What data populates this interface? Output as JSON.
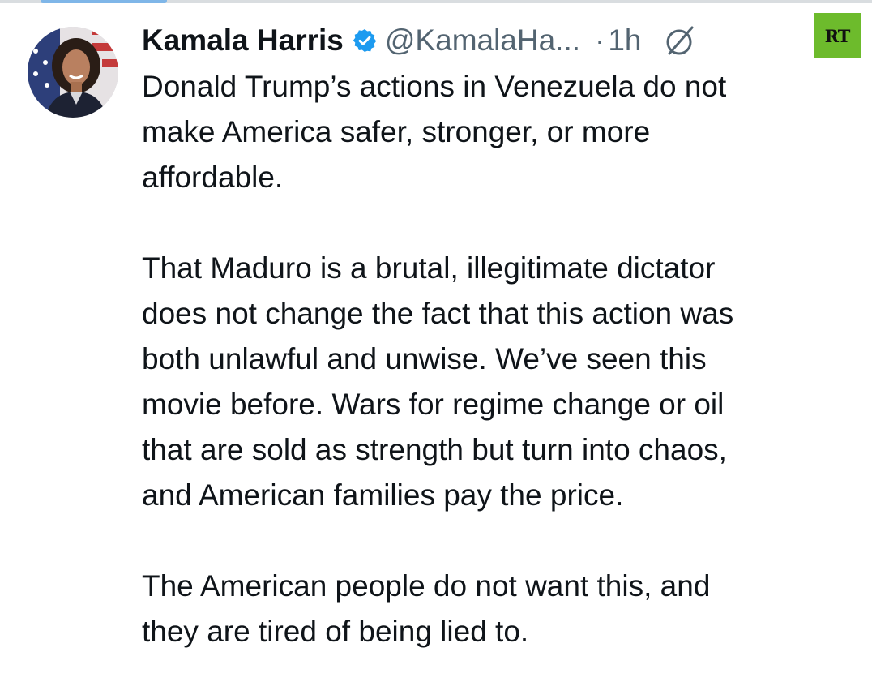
{
  "tweet": {
    "display_name": "Kamala Harris",
    "handle": "@KamalaHa...",
    "separator": "·",
    "timestamp": "1h",
    "paragraphs": [
      [
        "Donald Trump’s actions in Venezuela do not",
        "make America safer, stronger, or more",
        "affordable."
      ],
      [
        "That Maduro is a brutal, illegitimate dictator",
        "does not change the fact that this action was",
        "both unlawful and unwise. We’ve seen this",
        "movie before. Wars for regime change or oil",
        "that are sold as strength but turn into chaos,",
        "and American families pay the price."
      ],
      [
        "The American people do not want this, and",
        "they are tired of being lied to."
      ]
    ]
  },
  "watermark": {
    "text": "RT",
    "color": "#6dbb2c"
  },
  "icons": {
    "verified": "verified-badge-icon",
    "grok": "grok-icon"
  },
  "colors": {
    "text": "#0f1419",
    "secondary_text": "#536471",
    "verified_blue": "#1d9bf0"
  }
}
